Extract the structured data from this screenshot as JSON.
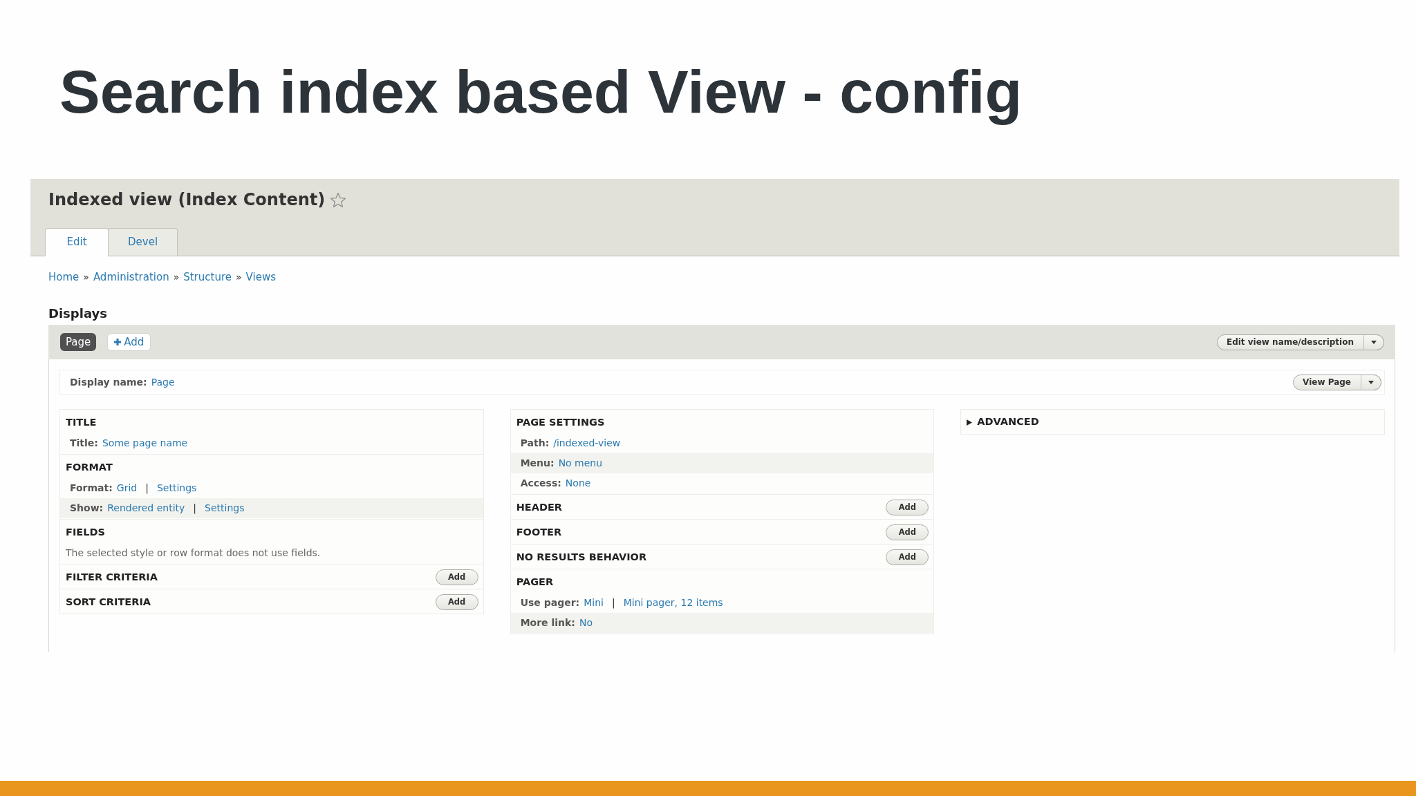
{
  "slide_title": "Search index based View - config",
  "page_header": {
    "title": "Indexed view (Index Content)",
    "starred": false
  },
  "tabs": [
    {
      "label": "Edit",
      "selected": true
    },
    {
      "label": "Devel",
      "selected": false
    }
  ],
  "breadcrumb": [
    {
      "label": "Home",
      "separator": "»"
    },
    {
      "label": "Administration",
      "separator": "»"
    },
    {
      "label": "Structure",
      "separator": "»"
    },
    {
      "label": "Views"
    }
  ],
  "displays": {
    "heading": "Displays",
    "display_tabs": [
      {
        "label": "Page",
        "selected": true
      }
    ],
    "add_button": "Add",
    "edit_button": "Edit view name/description"
  },
  "display": {
    "name_label": "Display name:",
    "name_value": "Page",
    "view_button": "View Page",
    "columns": [
      {
        "sections": [
          {
            "heading": "TITLE",
            "rows": [
              {
                "label": "Title:",
                "values": [
                  {
                    "kind": "link",
                    "text": "Some page name"
                  }
                ]
              }
            ]
          },
          {
            "heading": "FORMAT",
            "rows": [
              {
                "label": "Format:",
                "values": [
                  {
                    "kind": "link",
                    "text": "Grid"
                  },
                  {
                    "kind": "divider",
                    "text": "|"
                  },
                  {
                    "kind": "link",
                    "text": "Settings"
                  }
                ]
              },
              {
                "label": "Show:",
                "values": [
                  {
                    "kind": "link",
                    "text": "Rendered entity"
                  },
                  {
                    "kind": "divider",
                    "text": "|"
                  },
                  {
                    "kind": "link",
                    "text": "Settings"
                  }
                ]
              }
            ]
          },
          {
            "heading": "FIELDS",
            "description": "The selected style or row format does not use fields."
          },
          {
            "heading": "FILTER CRITERIA",
            "add_button": "Add"
          },
          {
            "heading": "SORT CRITERIA",
            "add_button": "Add"
          }
        ]
      },
      {
        "sections": [
          {
            "heading": "PAGE SETTINGS",
            "rows": [
              {
                "label": "Path:",
                "values": [
                  {
                    "kind": "link",
                    "text": "/indexed-view"
                  }
                ]
              },
              {
                "label": "Menu:",
                "values": [
                  {
                    "kind": "link",
                    "text": "No menu"
                  }
                ]
              },
              {
                "label": "Access:",
                "values": [
                  {
                    "kind": "link",
                    "text": "None"
                  }
                ]
              }
            ]
          },
          {
            "heading": "HEADER",
            "add_button": "Add"
          },
          {
            "heading": "FOOTER",
            "add_button": "Add"
          },
          {
            "heading": "NO RESULTS BEHAVIOR",
            "add_button": "Add"
          },
          {
            "heading": "PAGER",
            "rows": [
              {
                "label": "Use pager:",
                "values": [
                  {
                    "kind": "link",
                    "text": "Mini"
                  },
                  {
                    "kind": "divider",
                    "text": "|"
                  },
                  {
                    "kind": "link",
                    "text": "Mini pager, 12 items"
                  }
                ]
              },
              {
                "label": "More link:",
                "values": [
                  {
                    "kind": "link",
                    "text": "No"
                  }
                ]
              }
            ]
          }
        ]
      },
      {
        "sections": [
          {
            "heading": "ADVANCED",
            "expanded": false
          }
        ]
      }
    ]
  }
}
